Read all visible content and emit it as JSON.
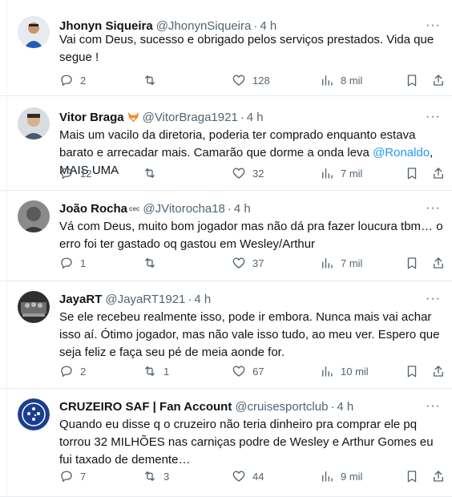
{
  "tweets": [
    {
      "name": "Jhonyn Siqueira",
      "handle": "@JhonynSiqueira",
      "dot": "·",
      "time": "4 h",
      "text": "Vai com Deus, sucesso e obrigado pelos serviços prestados. Vida que segue !",
      "replies": "2",
      "retweets": "",
      "likes": "128",
      "views": "8 mil",
      "avatar_color": "#1e5fb8"
    },
    {
      "name": "Vitor Braga",
      "handle": "@VitorBraga1921",
      "dot": "·",
      "time": "4 h",
      "text_before": "Mais um vacilo da diretoria, poderia ter comprado enquanto estava barato e arrecadar mais. Camarão que dorme a onda leva ",
      "mention": "@Ronaldo",
      "text_after": ", MAIS UMA",
      "replies": "12",
      "retweets": "",
      "likes": "32",
      "views": "7 mil",
      "avatar_color": "#cfd6da"
    },
    {
      "name": "João Rocha",
      "badge": "cec",
      "handle": "@JVitorocha18",
      "dot": "·",
      "time": "4 h",
      "text": "Vá com Deus, muito bom jogador mas não dá pra fazer loucura tbm… o erro foi ter gastado oq gastou em Wesley/Arthur",
      "replies": "1",
      "retweets": "",
      "likes": "37",
      "views": "7 mil",
      "avatar_color": "#6b6b6b"
    },
    {
      "name": "JayaRT",
      "handle": "@JayaRT1921",
      "dot": "·",
      "time": "4 h",
      "text": "Se ele recebeu realmente isso, pode ir embora. Nunca mais vai achar isso aí.  Ótimo jogador, mas não vale isso tudo, ao meu ver. Espero que seja feliz e faça seu pé de meia aonde for.",
      "replies": "2",
      "retweets": "1",
      "likes": "67",
      "views": "10 mil",
      "avatar_color": "#3b3b3b"
    },
    {
      "name": "CRUZEIRO SAF | Fan Account",
      "handle": "@cruisesportclub",
      "dot": "·",
      "time": "4 h",
      "text": "Quando eu disse q o cruzeiro não teria dinheiro pra comprar ele pq torrou 32 MILHÕES nas carniças podre de Wesley e Arthur Gomes eu fui taxado de demente…",
      "replies": "7",
      "retweets": "3",
      "likes": "44",
      "views": "9 mil",
      "avatar_color": "#1a3d8f"
    }
  ],
  "more_label": "···"
}
